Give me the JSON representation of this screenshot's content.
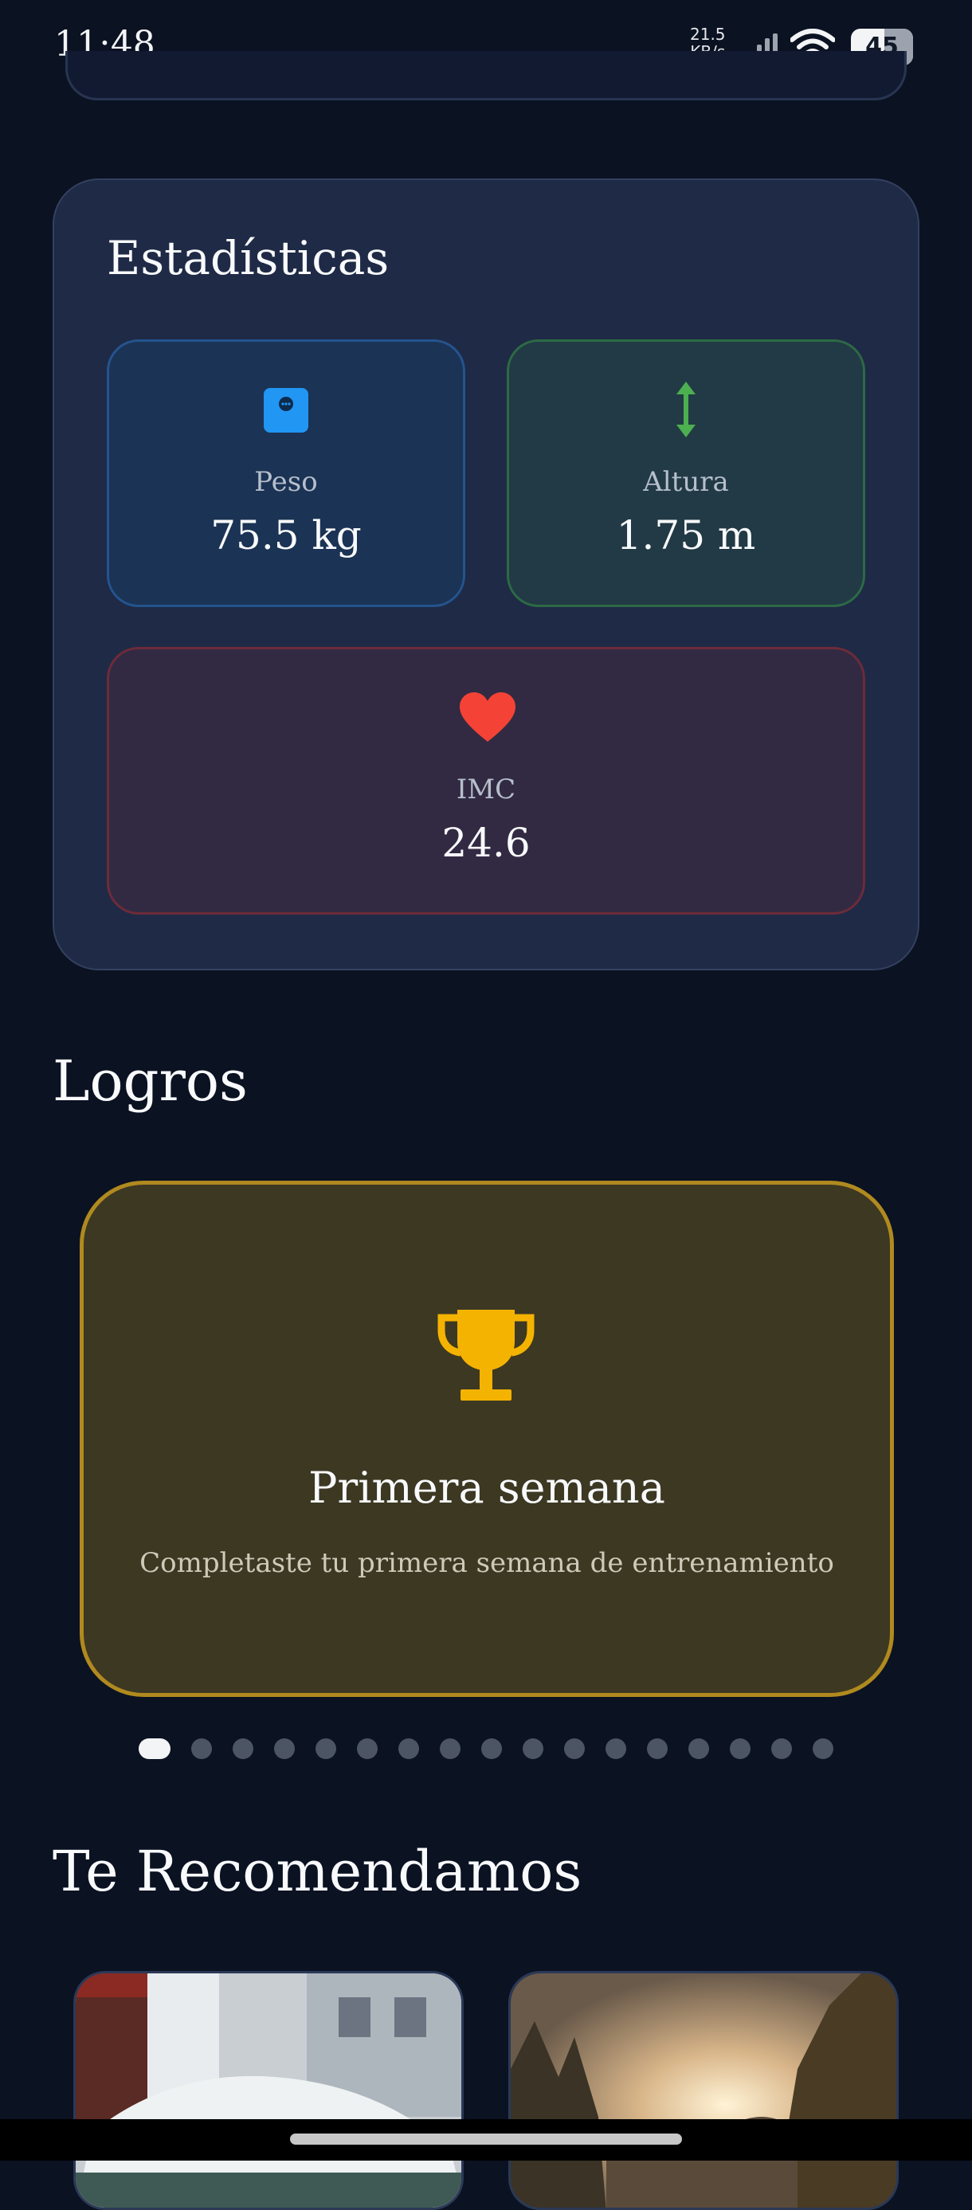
{
  "status_bar": {
    "time": "11:48",
    "net_speed_value": "21.5",
    "net_speed_unit": "KB/s",
    "battery": "45",
    "icons": [
      "signal-icon",
      "wifi-icon",
      "battery-icon"
    ]
  },
  "stats": {
    "title": "Estadísticas",
    "weight": {
      "label": "Peso",
      "value": "75.5 kg",
      "icon": "scale-icon",
      "color": "#2196f3"
    },
    "height": {
      "label": "Altura",
      "value": "1.75 m",
      "icon": "height-arrow-icon",
      "color": "#4caf50"
    },
    "bmi": {
      "label": "IMC",
      "value": "24.6",
      "icon": "heart-icon",
      "color": "#f44336"
    }
  },
  "achievements": {
    "title": "Logros",
    "current": {
      "icon": "trophy-icon",
      "name": "Primera semana",
      "description": "Completaste tu primera semana de entrenamiento",
      "accent": "#f5b301"
    },
    "page_count": 17,
    "active_index": 0
  },
  "recommendations": {
    "title": "Te Recomendamos",
    "items": [
      {
        "image": "street-car-photo"
      },
      {
        "image": "forest-sunset-photo"
      }
    ]
  }
}
